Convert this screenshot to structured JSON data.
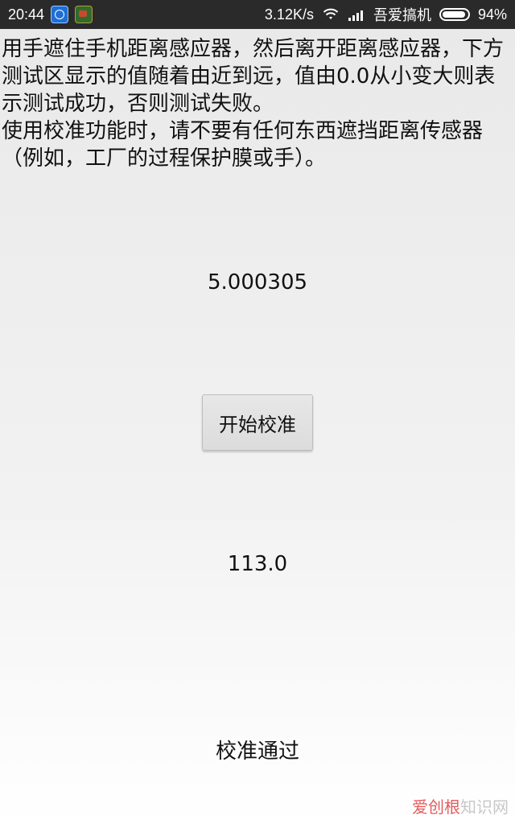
{
  "status_bar": {
    "time": "20:44",
    "network_speed": "3.12K/s",
    "carrier": "吾爱搞机",
    "battery_percent": "94%",
    "battery_level": 0.94,
    "icons": [
      "globe-icon",
      "gm-icon",
      "wifi-icon",
      "signal-icon",
      "battery-icon"
    ]
  },
  "instructions": {
    "text": "用手遮住手机距离感应器，然后离开距离感应器，下方测试区显示的值随着由近到远，值由0.0从小变大则表示测试成功，否则测试失败。\n使用校准功能时，请不要有任何东西遮挡距离传感器（例如，工厂的过程保护膜或手）。"
  },
  "measurements": {
    "top_value": "5.000305",
    "bottom_value": "113.0"
  },
  "actions": {
    "calibrate_label": "开始校准"
  },
  "result": {
    "status": "校准通过"
  },
  "watermark": {
    "text_accent": "爱创根",
    "text_rest": "知识网"
  }
}
